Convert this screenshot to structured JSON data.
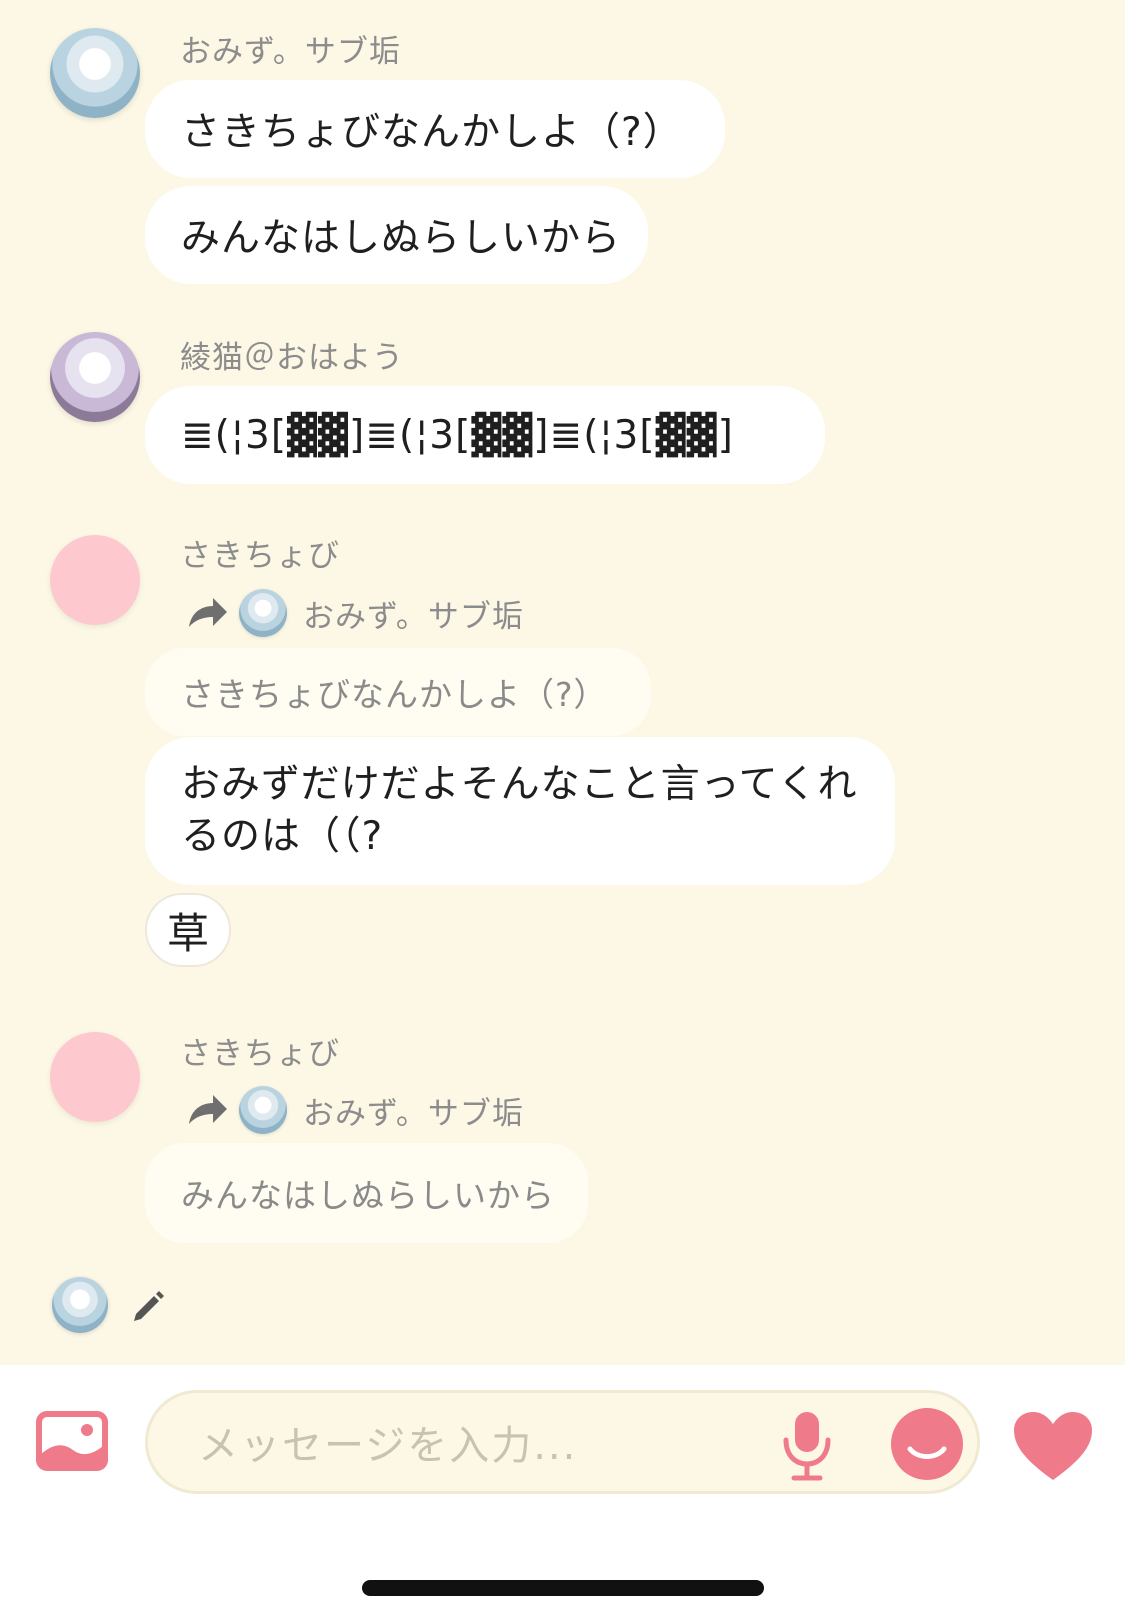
{
  "messages": [
    {
      "sender": "おみず。サブ垢",
      "bubbles": [
        "さきちょびなんかしよ（?）",
        "みんなはしぬらしいから"
      ]
    },
    {
      "sender": "綾猫＠おはよう",
      "bubbles": [
        "≣(¦3[▓▓]≣(¦3[▓▓]≣(¦3[▓▓]"
      ]
    },
    {
      "sender": "さきちょび",
      "reply_to": "おみず。サブ垢",
      "quote": "さきちょびなんかしよ（?）",
      "bubble": "おみずだけだよそんなこと言ってくれるのは（（?",
      "reaction": "草"
    },
    {
      "sender": "さきちょび",
      "reply_to": "おみず。サブ垢",
      "quote": "みんなはしぬらしいから"
    }
  ],
  "input": {
    "placeholder": "メッセージを入力..."
  },
  "icons": {
    "image": "image-icon",
    "mic": "mic-icon",
    "emoji": "emoji-icon",
    "heart": "heart-icon",
    "pencil": "pencil-icon",
    "reply": "reply-arrow-icon"
  },
  "colors": {
    "background": "#fdf8e6",
    "accent": "#ef7b8a",
    "bubble": "#ffffff",
    "pink_avatar": "#fdc9cf"
  }
}
